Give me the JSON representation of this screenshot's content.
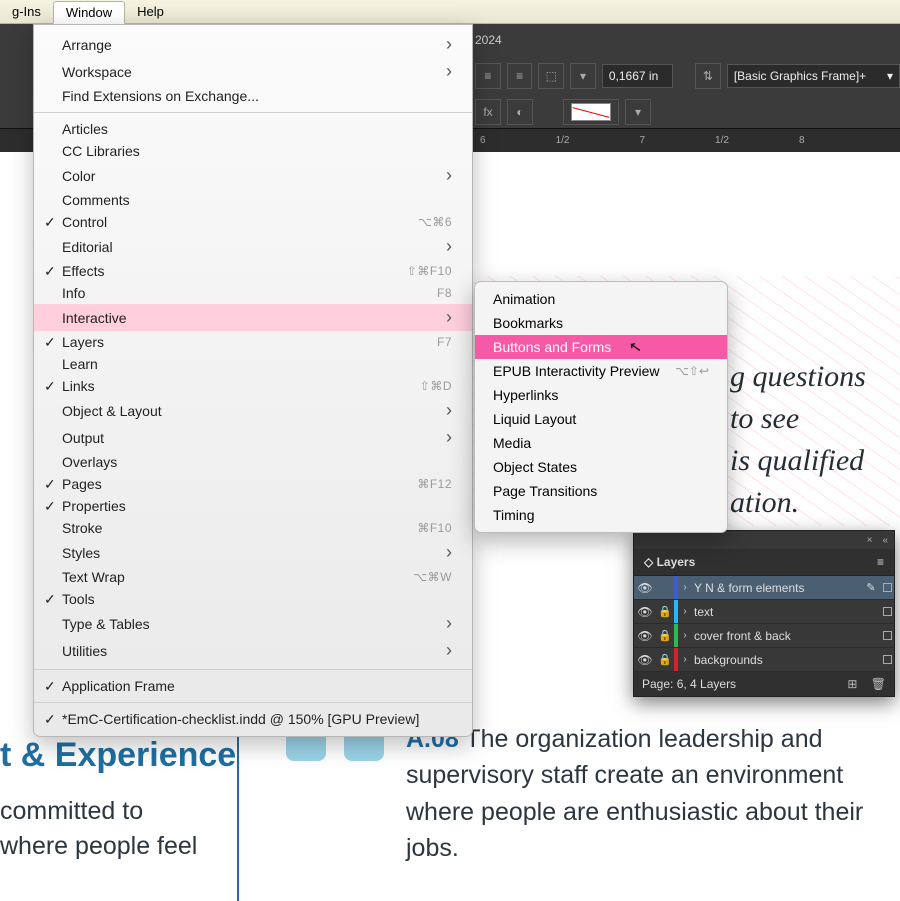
{
  "menubar": {
    "items": [
      "g-Ins",
      "Window",
      "Help"
    ]
  },
  "tab_title": "2024",
  "toolbar": {
    "value": "0,1667 in",
    "preset": "[Basic Graphics Frame]+"
  },
  "ruler_marks": [
    "6",
    "1/2",
    "7",
    "1/2",
    "8"
  ],
  "window_menu": [
    {
      "label": "Arrange",
      "arrow": true
    },
    {
      "label": "Workspace",
      "arrow": true
    },
    {
      "label": "Find Extensions on Exchange..."
    },
    {
      "sep": true
    },
    {
      "label": "Articles"
    },
    {
      "label": "CC Libraries"
    },
    {
      "label": "Color",
      "arrow": true
    },
    {
      "label": "Comments"
    },
    {
      "label": "Control",
      "checked": true,
      "hint": "⌥⌘6"
    },
    {
      "label": "Editorial",
      "arrow": true
    },
    {
      "label": "Effects",
      "checked": true,
      "hint": "⇧⌘F10"
    },
    {
      "label": "Info",
      "hint": "F8"
    },
    {
      "label": "Interactive",
      "arrow": true,
      "hover": true
    },
    {
      "label": "Layers",
      "checked": true,
      "hint": "F7"
    },
    {
      "label": "Learn"
    },
    {
      "label": "Links",
      "checked": true,
      "hint": "⇧⌘D"
    },
    {
      "label": "Object & Layout",
      "arrow": true
    },
    {
      "label": "Output",
      "arrow": true
    },
    {
      "label": "Overlays"
    },
    {
      "label": "Pages",
      "checked": true,
      "hint": "⌘F12"
    },
    {
      "label": "Properties",
      "checked": true
    },
    {
      "label": "Stroke",
      "hint": "⌘F10"
    },
    {
      "label": "Styles",
      "arrow": true
    },
    {
      "label": "Text Wrap",
      "hint": "⌥⌘W"
    },
    {
      "label": "Tools",
      "checked": true
    },
    {
      "label": "Type & Tables",
      "arrow": true
    },
    {
      "label": "Utilities",
      "arrow": true
    },
    {
      "sep": true
    },
    {
      "label": "Application Frame",
      "checked": true
    },
    {
      "sep": true
    },
    {
      "label": "*EmC-Certification-checklist.indd @ 150% [GPU Preview]",
      "checked": true
    }
  ],
  "submenu": [
    {
      "label": "Animation"
    },
    {
      "label": "Bookmarks"
    },
    {
      "label": "Buttons and Forms",
      "sel": true
    },
    {
      "label": "EPUB Interactivity Preview",
      "hint": "⌥⇧↩"
    },
    {
      "label": "Hyperlinks"
    },
    {
      "label": "Liquid Layout"
    },
    {
      "label": "Media"
    },
    {
      "label": "Object States"
    },
    {
      "label": "Page Transitions"
    },
    {
      "label": "Timing"
    }
  ],
  "doc": {
    "quote_l1": "g questions",
    "quote_l2": "to see",
    "quote_l3": "is qualified",
    "quote_l4": "ation.",
    "section_head": "t & Experience",
    "sec_line1": "committed to",
    "sec_line2": "where people feel",
    "item_code": "A.08",
    "item_text": " The organization leadership and supervisory staff create an environment where people are enthusiastic about their jobs."
  },
  "layers": {
    "title": "Layers",
    "rows": [
      {
        "name": "Y N & form elements",
        "color": "#3c5ccf",
        "sel": true,
        "locked": false
      },
      {
        "name": "text",
        "color": "#28b4ff",
        "locked": true
      },
      {
        "name": "cover front & back",
        "color": "#2fb84b",
        "locked": true
      },
      {
        "name": "backgrounds",
        "color": "#d4232a",
        "locked": true
      }
    ],
    "footer": "Page: 6, 4 Layers"
  }
}
